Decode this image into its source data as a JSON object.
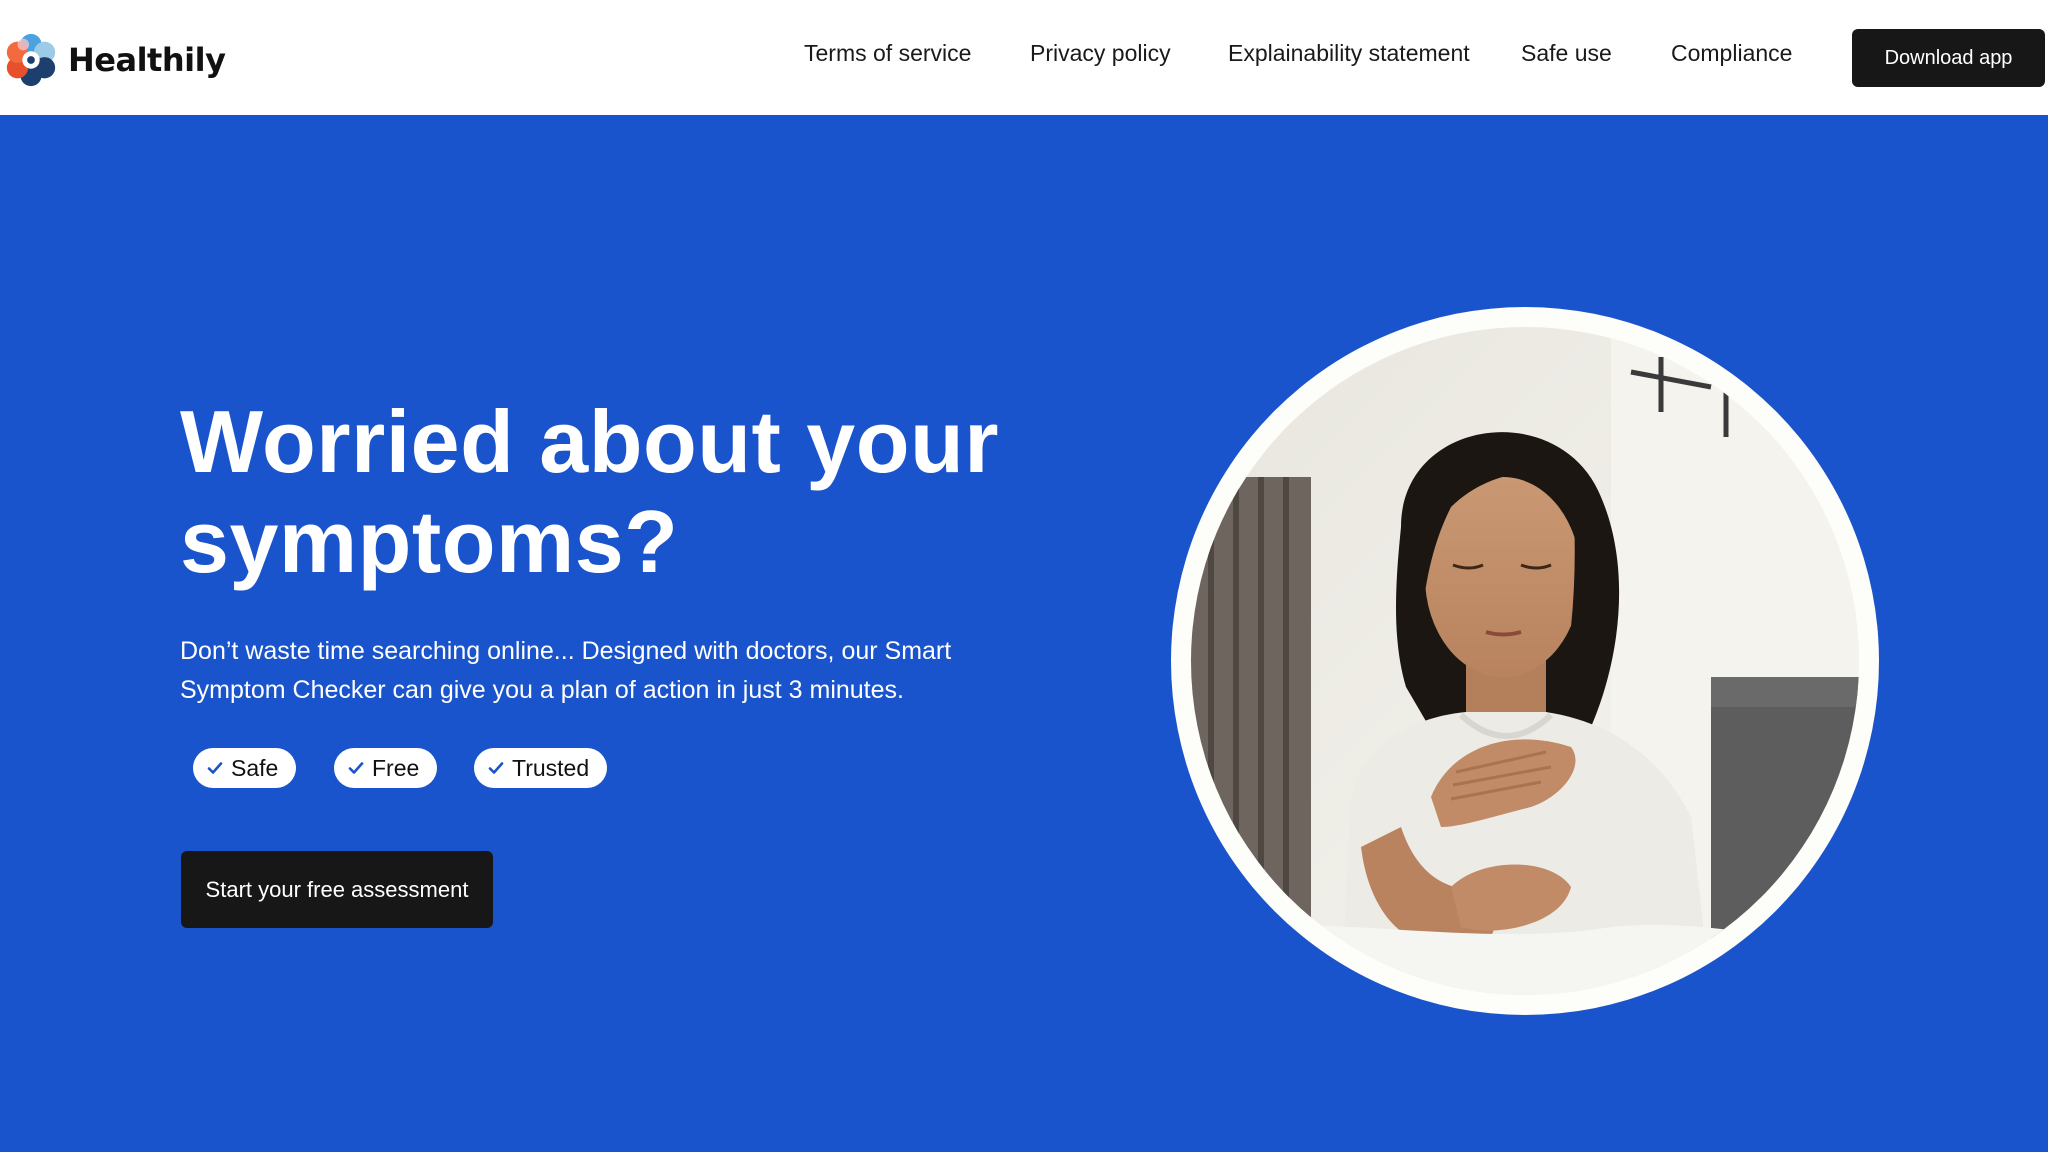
{
  "brand": {
    "name": "Healthily",
    "logo_icon": "healthily-flower-logo-icon"
  },
  "nav": {
    "links": [
      {
        "label": "Terms of service"
      },
      {
        "label": "Privacy policy"
      },
      {
        "label": "Explainability statement"
      },
      {
        "label": "Safe use"
      },
      {
        "label": "Compliance"
      }
    ],
    "download_label": "Download app"
  },
  "hero": {
    "title_line1": "Worried about your",
    "title_line2": "symptoms?",
    "subtitle_line1": "Don’t waste time searching online... Designed with doctors, our Smart",
    "subtitle_line2": "Symptom Checker can give you a plan of action in just 3 minutes.",
    "badges": [
      {
        "label": "Safe",
        "icon": "check-icon"
      },
      {
        "label": "Free",
        "icon": "check-icon"
      },
      {
        "label": "Trusted",
        "icon": "check-icon"
      }
    ],
    "cta_label": "Start your free assessment",
    "image": {
      "subject": "woman-holding-chest-photo"
    }
  },
  "colors": {
    "hero_background": "#1a54cc",
    "header_background": "#ffffff",
    "button_background": "#171717",
    "check_color": "#1a54cc",
    "logo_colors": [
      "#1d3f6e",
      "#4aa3e0",
      "#f26a3d",
      "#e84f2c",
      "#9ccbe8",
      "#f0c3c8"
    ]
  }
}
